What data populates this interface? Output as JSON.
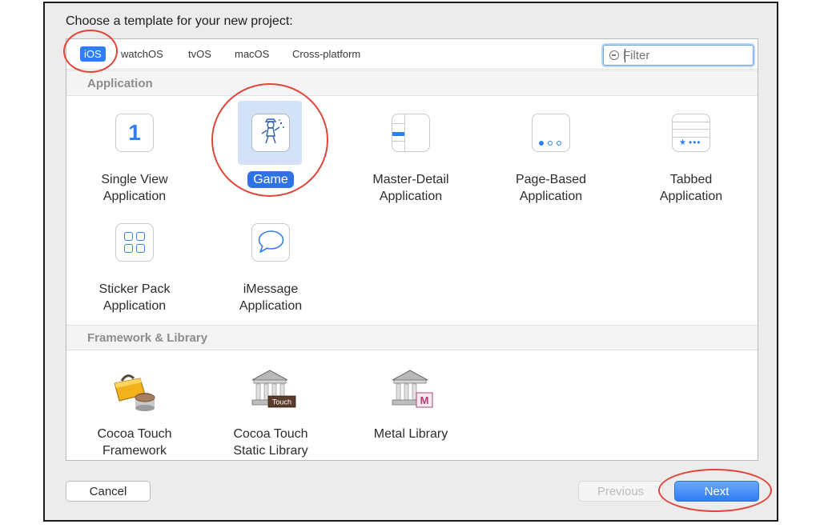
{
  "dialog": {
    "title": "Choose a template for your new project:",
    "platform_tabs": [
      {
        "label": "iOS",
        "selected": true
      },
      {
        "label": "watchOS",
        "selected": false
      },
      {
        "label": "tvOS",
        "selected": false
      },
      {
        "label": "macOS",
        "selected": false
      },
      {
        "label": "Cross-platform",
        "selected": false
      }
    ],
    "filter": {
      "placeholder": "Filter",
      "value": ""
    },
    "sections": [
      {
        "title": "Application",
        "items": [
          {
            "label": [
              "Single View",
              "Application"
            ],
            "icon": "single-view-icon",
            "selected": false
          },
          {
            "label": [
              "Game"
            ],
            "icon": "game-icon",
            "selected": true
          },
          {
            "label": [
              "Master-Detail",
              "Application"
            ],
            "icon": "master-detail-icon",
            "selected": false
          },
          {
            "label": [
              "Page-Based",
              "Application"
            ],
            "icon": "page-based-icon",
            "selected": false
          },
          {
            "label": [
              "Tabbed",
              "Application"
            ],
            "icon": "tabbed-icon",
            "selected": false
          },
          {
            "label": [
              "Sticker Pack",
              "Application"
            ],
            "icon": "sticker-pack-icon",
            "selected": false
          },
          {
            "label": [
              "iMessage",
              "Application"
            ],
            "icon": "imessage-icon",
            "selected": false
          }
        ]
      },
      {
        "title": "Framework & Library",
        "items": [
          {
            "label": [
              "Cocoa Touch",
              "Framework"
            ],
            "icon": "toolbox-icon",
            "selected": false
          },
          {
            "label": [
              "Cocoa Touch",
              "Static Library"
            ],
            "icon": "library-building-icon",
            "badge": "Touch",
            "selected": false
          },
          {
            "label": [
              "Metal Library"
            ],
            "icon": "metal-library-icon",
            "badge": "M",
            "selected": false
          }
        ]
      }
    ],
    "buttons": {
      "cancel": "Cancel",
      "previous": "Previous",
      "next": "Next"
    },
    "colors": {
      "accent": "#2f7ef6",
      "annotation": "#e0453a",
      "section_text": "#8c8c8c"
    }
  }
}
